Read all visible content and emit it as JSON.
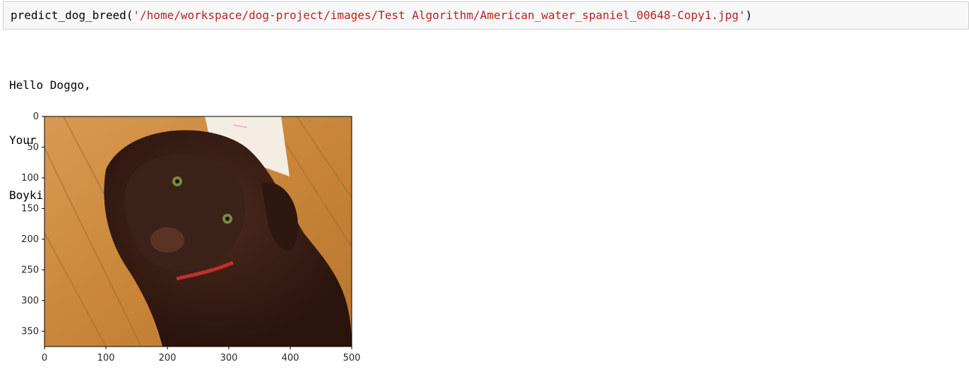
{
  "cell": {
    "function_name": "predict_dog_breed",
    "open_paren": "(",
    "argument": "'/home/workspace/dog-project/images/Test Algorithm/American_water_spaniel_00648-Copy1.jpg'",
    "close_paren": ")"
  },
  "output": {
    "lines": [
      "Hello Doggo,",
      "Your predicted breed is ...",
      "Boykin_spaniel"
    ]
  },
  "chart_data": {
    "type": "image",
    "x_ticks": [
      "0",
      "100",
      "200",
      "300",
      "400",
      "500"
    ],
    "y_ticks": [
      "0",
      "50",
      "100",
      "150",
      "200",
      "250",
      "300",
      "350"
    ],
    "xlim": [
      0,
      500
    ],
    "ylim": [
      375,
      0
    ]
  }
}
